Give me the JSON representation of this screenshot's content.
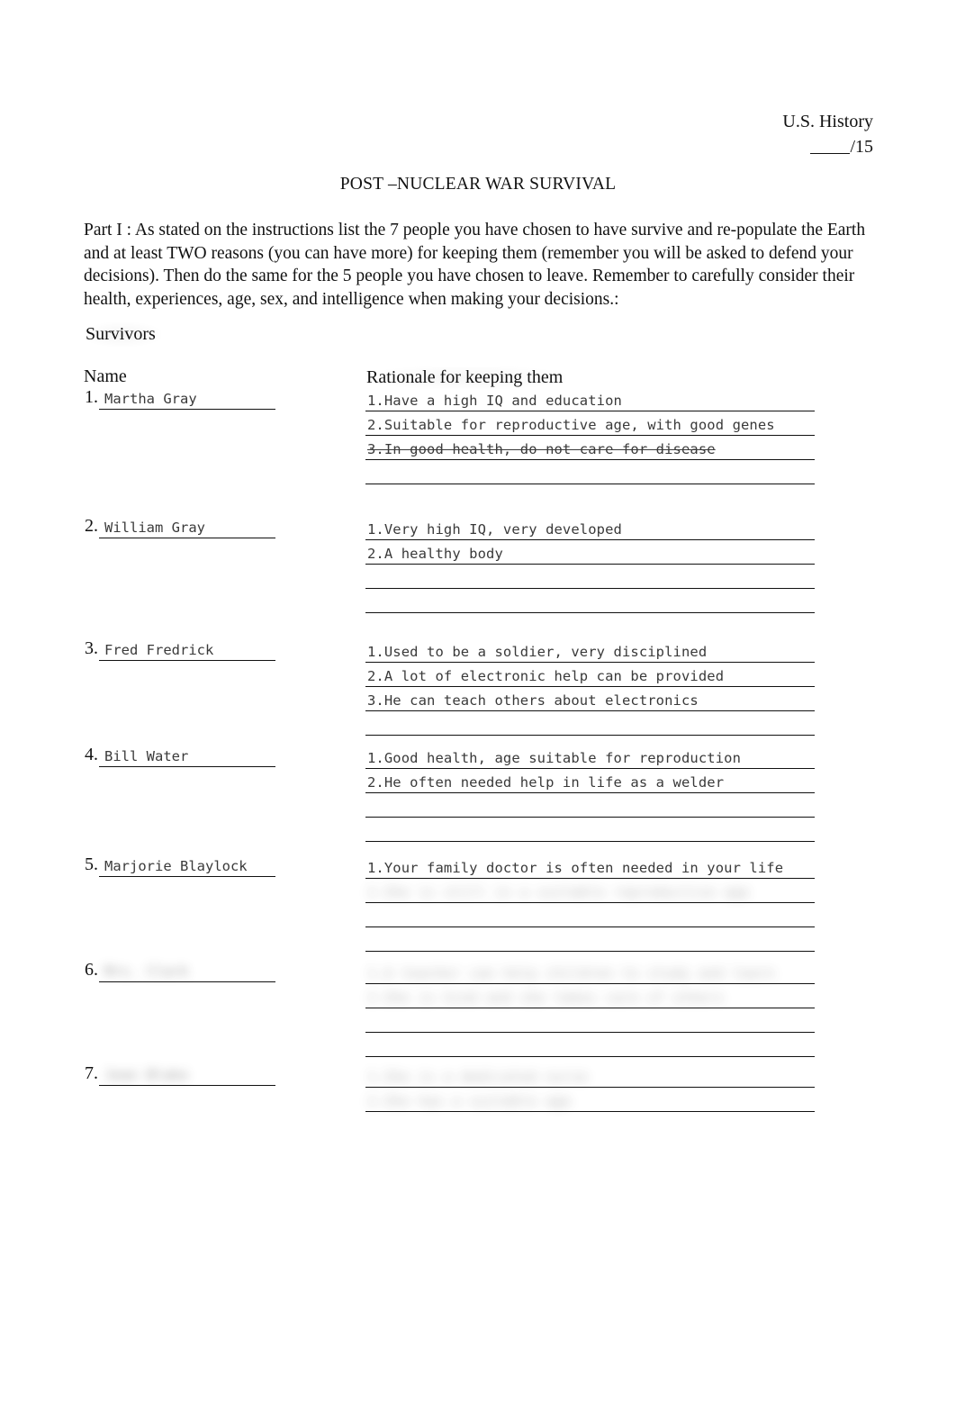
{
  "header": {
    "course": "U.S. History",
    "score_blank": "",
    "score_total": "/15"
  },
  "title": "POST –NUCLEAR WAR SURVIVAL",
  "instructions": "Part I : As stated on the instructions list the 7 people you have chosen to have survive and re-populate the Earth and at least TWO reasons (you can have more) for keeping them (remember you will be asked to defend your decisions). Then do the same for the 5 people you have chosen to leave. Remember to carefully consider their health, experiences, age, sex, and intelligence when making your decisions.:",
  "section_heading": "Survivors",
  "columns": {
    "name": "Name",
    "rationale": "Rationale for keeping them"
  },
  "entries": [
    {
      "number": "1.",
      "name": "Martha Gray",
      "name_redacted": false,
      "rationales": [
        {
          "text": "1.Have a high IQ and education",
          "struck": false,
          "redacted": false
        },
        {
          "text": "2.Suitable for reproductive age, with good genes",
          "struck": false,
          "redacted": false
        },
        {
          "text": "3.In good health, do not care for disease",
          "struck": true,
          "redacted": false
        },
        {
          "text": "",
          "struck": false,
          "redacted": false
        }
      ]
    },
    {
      "number": "2.",
      "name": "William Gray",
      "name_redacted": false,
      "rationales": [
        {
          "text": "1.Very high IQ, very developed",
          "struck": false,
          "redacted": false
        },
        {
          "text": "2.A healthy body",
          "struck": false,
          "redacted": false
        },
        {
          "text": "",
          "struck": false,
          "redacted": false
        },
        {
          "text": "",
          "struck": false,
          "redacted": false
        }
      ]
    },
    {
      "number": "3.",
      "name": "Fred Fredrick",
      "name_redacted": false,
      "rationales": [
        {
          "text": "1.Used to be a soldier, very disciplined",
          "struck": false,
          "redacted": false
        },
        {
          "text": "2.A lot of electronic help can be provided",
          "struck": false,
          "redacted": false
        },
        {
          "text": "3.He can teach others about electronics",
          "struck": false,
          "redacted": false
        },
        {
          "text": "",
          "struck": false,
          "redacted": false
        }
      ]
    },
    {
      "number": "4.",
      "name": "Bill Water",
      "name_redacted": false,
      "rationales": [
        {
          "text": "1.Good health, age suitable for reproduction",
          "struck": false,
          "redacted": false
        },
        {
          "text": "2.He often needed help in life as a welder",
          "struck": false,
          "redacted": false
        },
        {
          "text": "",
          "struck": false,
          "redacted": false
        },
        {
          "text": "",
          "struck": false,
          "redacted": false
        }
      ]
    },
    {
      "number": "5.",
      "name": "Marjorie Blaylock",
      "name_redacted": false,
      "rationales": [
        {
          "text": "1.Your family doctor is often needed in your life",
          "struck": false,
          "redacted": false
        },
        {
          "text": "2.She is still in a suitable reproductive age",
          "struck": false,
          "redacted": true
        },
        {
          "text": "",
          "struck": false,
          "redacted": false
        },
        {
          "text": "",
          "struck": false,
          "redacted": false
        }
      ]
    },
    {
      "number": "6.",
      "name": "Mrs. Clark",
      "name_redacted": true,
      "rationales": [
        {
          "text": "1.A teacher can help children to study and learn",
          "struck": false,
          "redacted": true
        },
        {
          "text": "2.She is kind and she takes care of others",
          "struck": false,
          "redacted": true
        },
        {
          "text": "",
          "struck": false,
          "redacted": false
        },
        {
          "text": "",
          "struck": false,
          "redacted": false
        }
      ]
    },
    {
      "number": "7.",
      "name": "Jean Blake",
      "name_redacted": true,
      "rationales": [
        {
          "text": "1.She is a dedicated nurse",
          "struck": false,
          "redacted": true
        },
        {
          "text": "2.She has a suitable age",
          "struck": false,
          "redacted": true
        }
      ]
    }
  ]
}
